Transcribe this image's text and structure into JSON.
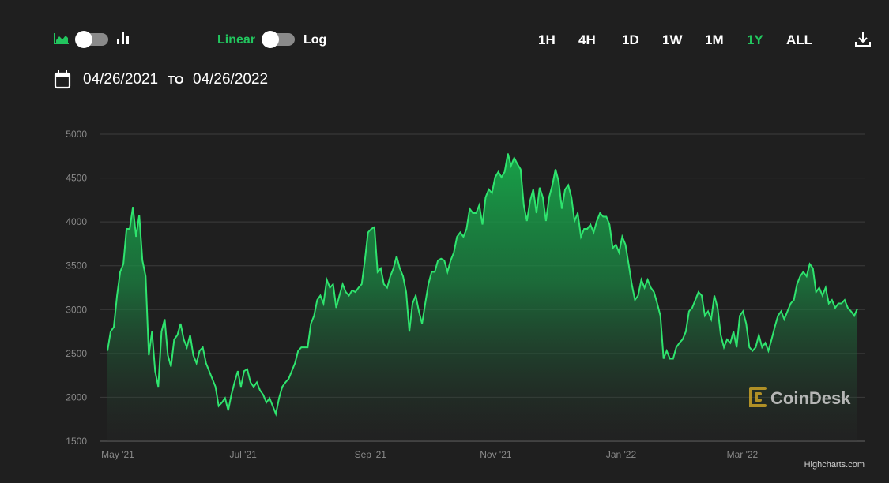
{
  "controls": {
    "chart_type_icons": [
      "area-chart-icon",
      "bar-chart-icon"
    ],
    "scale_linear": "Linear",
    "scale_log": "Log",
    "ranges": [
      "1H",
      "4H",
      "1D",
      "1W",
      "1M",
      "1Y",
      "ALL"
    ],
    "active_range": "1Y",
    "download_icon": "download-icon",
    "date_from": "04/26/2021",
    "date_to_label": "TO",
    "date_to": "04/26/2022"
  },
  "colors": {
    "accent": "#22c55e",
    "line": "#2fe46e",
    "background": "#1f1f1f"
  },
  "watermark": "CoinDesk",
  "credits": "Highcharts.com",
  "chart_data": {
    "type": "area",
    "title": "",
    "xlabel": "",
    "ylabel": "",
    "x_start": "2021-04-26",
    "x_end": "2022-04-26",
    "ylim": [
      1500,
      5000
    ],
    "yticks": [
      1500,
      2000,
      2500,
      3000,
      3500,
      4000,
      4500,
      5000
    ],
    "xticks": [
      {
        "label": "May '21",
        "date": "2021-05-01"
      },
      {
        "label": "Jul '21",
        "date": "2021-07-01"
      },
      {
        "label": "Sep '21",
        "date": "2021-09-01"
      },
      {
        "label": "Nov '21",
        "date": "2021-11-01"
      },
      {
        "label": "Jan '22",
        "date": "2022-01-01"
      },
      {
        "label": "Mar '22",
        "date": "2022-03-01"
      }
    ],
    "grid": true,
    "legend": "none",
    "values": [
      2530,
      2750,
      2800,
      3160,
      3430,
      3520,
      3920,
      3920,
      4170,
      3830,
      4080,
      3560,
      3380,
      2480,
      2750,
      2300,
      2120,
      2750,
      2890,
      2480,
      2350,
      2660,
      2710,
      2840,
      2660,
      2570,
      2710,
      2480,
      2390,
      2530,
      2570,
      2390,
      2300,
      2210,
      2120,
      1900,
      1940,
      1990,
      1850,
      2030,
      2170,
      2300,
      2120,
      2300,
      2320,
      2170,
      2120,
      2170,
      2080,
      2030,
      1940,
      1990,
      1900,
      1810,
      1990,
      2120,
      2170,
      2210,
      2300,
      2390,
      2530,
      2570,
      2570,
      2570,
      2840,
      2930,
      3110,
      3160,
      3070,
      3340,
      3250,
      3290,
      3020,
      3160,
      3290,
      3200,
      3160,
      3220,
      3200,
      3250,
      3290,
      3560,
      3880,
      3920,
      3940,
      3430,
      3470,
      3290,
      3250,
      3380,
      3470,
      3610,
      3470,
      3380,
      3200,
      2750,
      3070,
      3160,
      2980,
      2840,
      3070,
      3290,
      3430,
      3430,
      3560,
      3580,
      3560,
      3430,
      3560,
      3650,
      3830,
      3880,
      3830,
      3920,
      4150,
      4100,
      4100,
      4190,
      3970,
      4280,
      4370,
      4330,
      4510,
      4570,
      4510,
      4570,
      4780,
      4640,
      4730,
      4660,
      4600,
      4190,
      4010,
      4240,
      4370,
      4100,
      4390,
      4280,
      4010,
      4280,
      4420,
      4600,
      4460,
      4150,
      4370,
      4420,
      4280,
      4010,
      4100,
      3830,
      3920,
      3920,
      3970,
      3880,
      4010,
      4100,
      4060,
      4060,
      3970,
      3700,
      3740,
      3650,
      3830,
      3740,
      3520,
      3290,
      3110,
      3160,
      3340,
      3250,
      3340,
      3250,
      3200,
      3070,
      2930,
      2440,
      2530,
      2440,
      2440,
      2570,
      2620,
      2660,
      2750,
      2980,
      3020,
      3110,
      3200,
      3160,
      2930,
      2980,
      2890,
      3160,
      3020,
      2710,
      2570,
      2660,
      2620,
      2750,
      2570,
      2930,
      2980,
      2840,
      2570,
      2530,
      2570,
      2710,
      2570,
      2620,
      2530,
      2660,
      2800,
      2930,
      2980,
      2890,
      2980,
      3070,
      3110,
      3290,
      3380,
      3430,
      3380,
      3520,
      3470,
      3200,
      3250,
      3160,
      3250,
      3070,
      3110,
      3020,
      3070,
      3070,
      3110,
      3020,
      2980,
      2930,
      3010
    ]
  }
}
